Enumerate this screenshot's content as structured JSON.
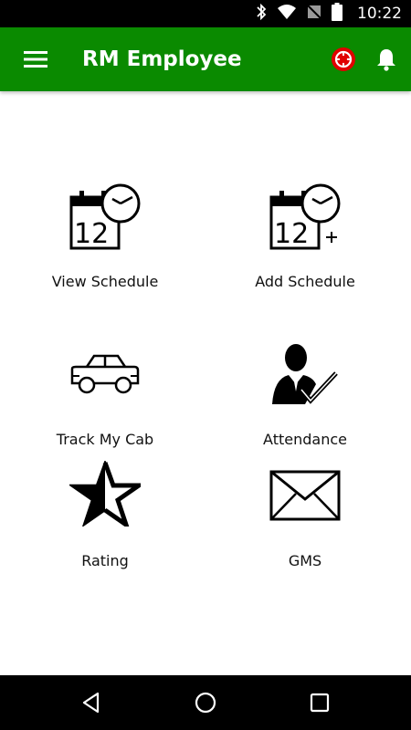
{
  "status_bar": {
    "time": "10:22",
    "icons": [
      "bluetooth-icon",
      "wifi-icon",
      "no-sim-icon",
      "battery-icon"
    ]
  },
  "app_bar": {
    "title": "RM Employee",
    "menu_icon": "menu-icon",
    "sos_icon": "sos-icon",
    "notification_icon": "bell-icon",
    "bar_color": "#0a8a00",
    "sos_color": "#e00000"
  },
  "tiles": [
    {
      "label": "View Schedule",
      "icon": "calendar-clock-icon",
      "calendar_day": "12"
    },
    {
      "label": "Add Schedule",
      "icon": "calendar-clock-add-icon",
      "calendar_day": "12"
    },
    {
      "label": "Track My Cab",
      "icon": "car-icon"
    },
    {
      "label": "Attendance",
      "icon": "attendance-icon"
    },
    {
      "label": "Rating",
      "icon": "star-half-icon"
    },
    {
      "label": "GMS",
      "icon": "envelope-icon"
    }
  ],
  "nav_bar": {
    "icons": [
      "back-icon",
      "home-icon",
      "recents-icon"
    ]
  }
}
